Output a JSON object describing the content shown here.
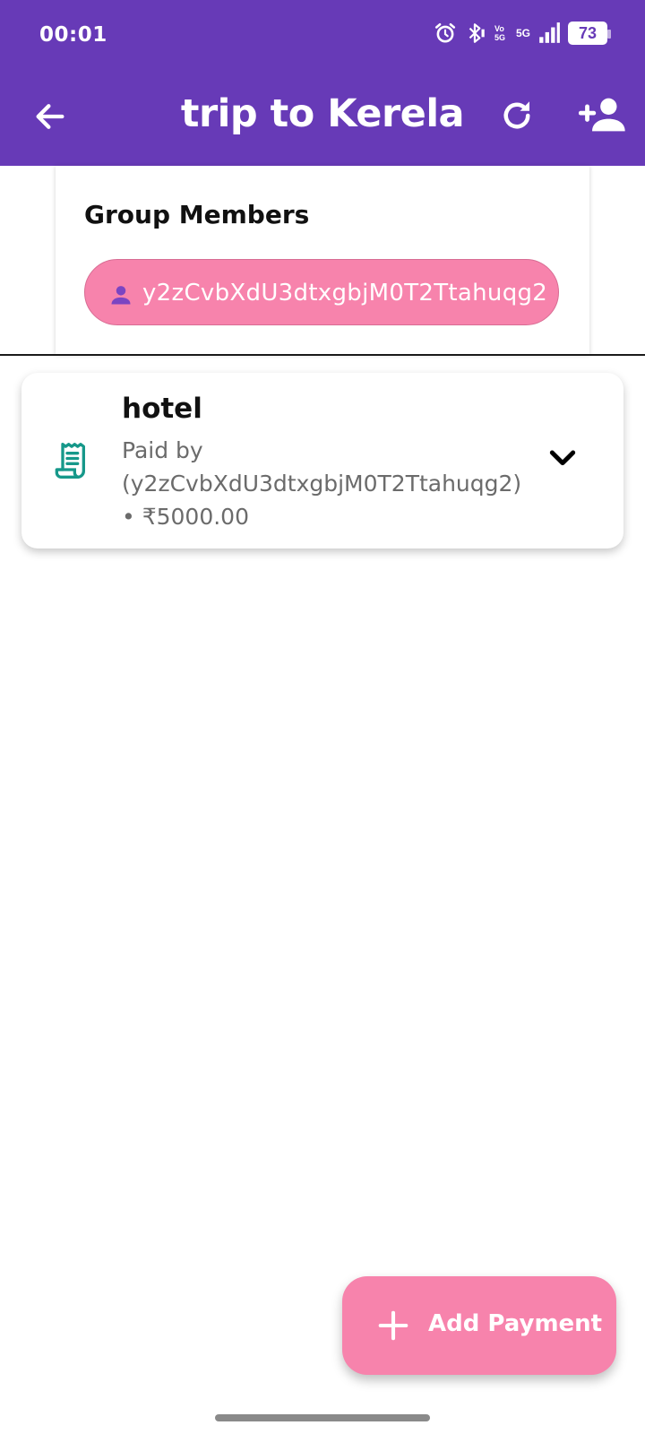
{
  "status_bar": {
    "time": "00:01",
    "network_label": "5G",
    "volte_label": "Vo 5G",
    "battery": "73"
  },
  "app_bar": {
    "title": "trip to Kerela",
    "back_icon": "arrow-left-icon",
    "refresh_icon": "refresh-icon",
    "add_member_icon": "person-add-icon"
  },
  "group_members": {
    "heading": "Group Members",
    "members": [
      {
        "name": "y2zCvbXdU3dtxgbjM0T2Ttahuqg2",
        "icon": "person-icon"
      }
    ]
  },
  "expenses": [
    {
      "title": "hotel",
      "paid_by_line1": "Paid by",
      "paid_by_line2": "(y2zCvbXdU3dtxgbjM0T2Ttahuqg2)",
      "amount_line": "• ₹5000.00",
      "icon": "receipt-icon"
    }
  ],
  "fab": {
    "label": "Add Payment",
    "icon": "plus-icon"
  },
  "colors": {
    "primary": "#673AB7",
    "accent_pink": "#F783AC",
    "receipt_teal": "#16988A",
    "subtext": "#6b6b6b"
  }
}
